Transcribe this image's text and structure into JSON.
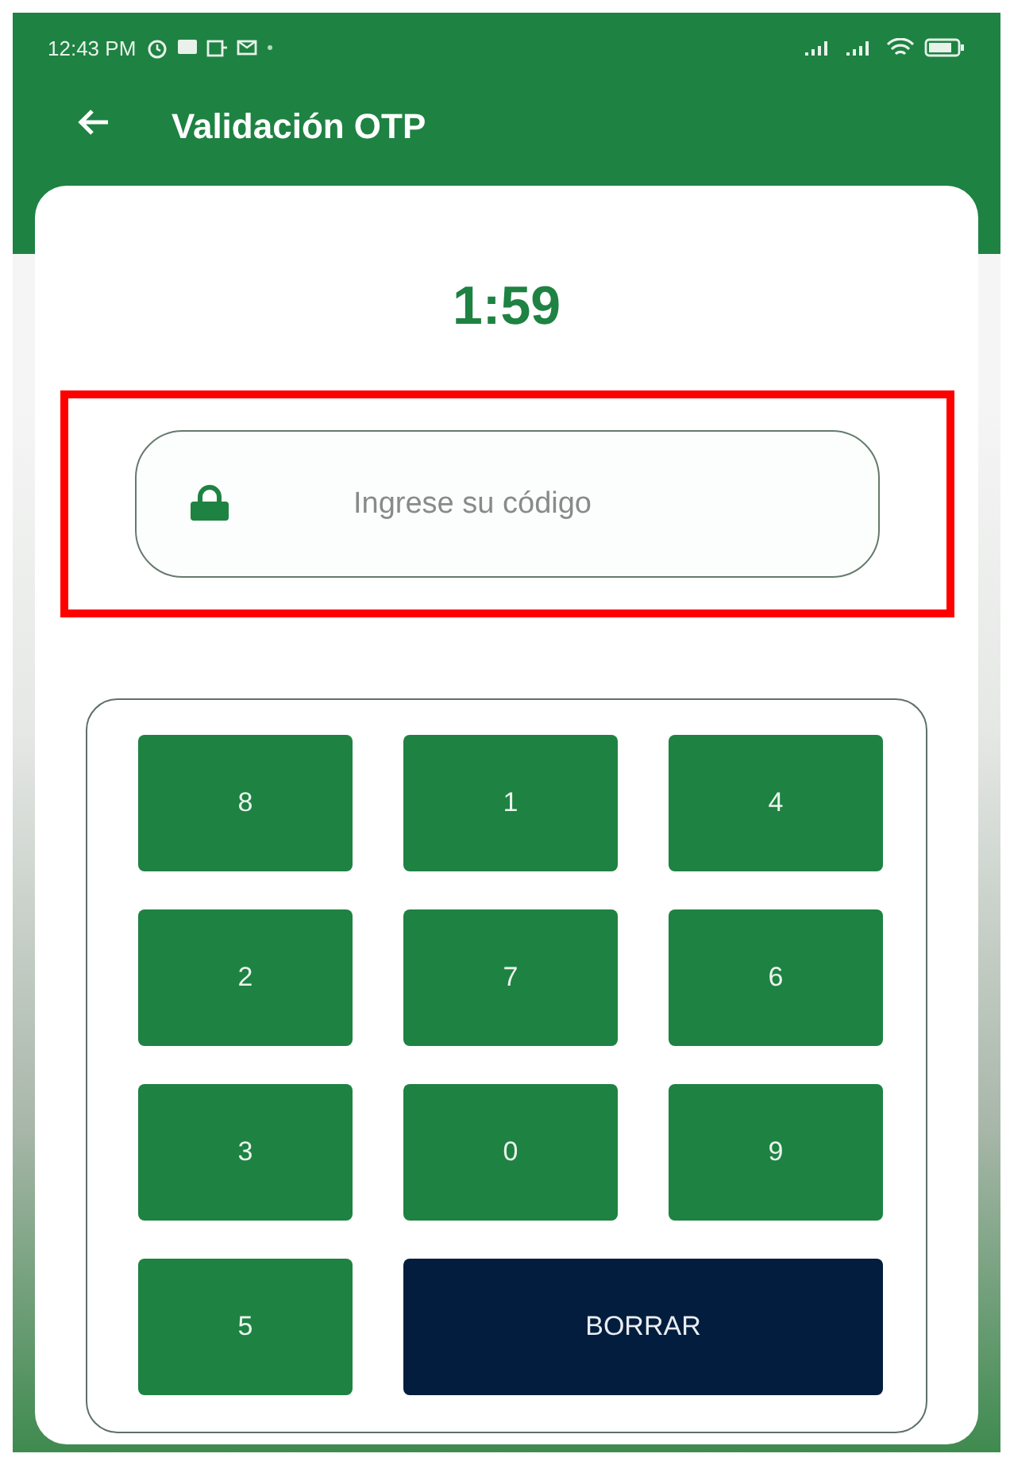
{
  "status_bar": {
    "time": "12:43 PM"
  },
  "header": {
    "title": "Validación OTP"
  },
  "timer": "1:59",
  "code_field": {
    "placeholder": "Ingrese su código",
    "highlighted": true
  },
  "keypad": [
    {
      "label": "8",
      "kind": "digit"
    },
    {
      "label": "1",
      "kind": "digit"
    },
    {
      "label": "4",
      "kind": "digit"
    },
    {
      "label": "2",
      "kind": "digit"
    },
    {
      "label": "7",
      "kind": "digit"
    },
    {
      "label": "6",
      "kind": "digit"
    },
    {
      "label": "3",
      "kind": "digit"
    },
    {
      "label": "0",
      "kind": "digit"
    },
    {
      "label": "9",
      "kind": "digit"
    },
    {
      "label": "5",
      "kind": "digit"
    },
    {
      "label": "BORRAR",
      "kind": "delete"
    }
  ]
}
